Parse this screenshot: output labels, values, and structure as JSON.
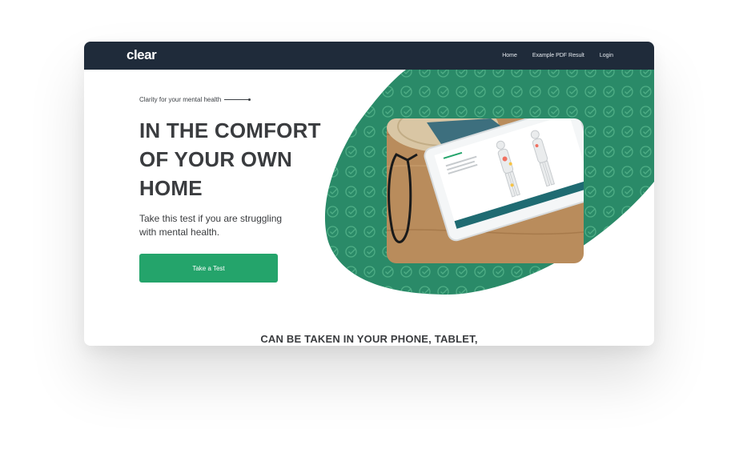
{
  "nav": {
    "logo": "clear",
    "links": [
      "Home",
      "Example PDF Result",
      "Login"
    ]
  },
  "hero": {
    "tagline": "Clarity for your mental health",
    "title_lines": [
      "IN THE COMFORT",
      "OF YOUR OWN",
      "HOME"
    ],
    "subtitle_lines": [
      "Take this test if you are struggling",
      "with mental health."
    ],
    "cta_label": "Take a Test"
  },
  "section": {
    "heading": "CAN BE TAKEN IN YOUR PHONE, TABLET,"
  },
  "colors": {
    "navbar": "#1f2b3a",
    "accent_green": "#24a46b",
    "blob_green": "#2a8a68",
    "text_dark": "#3a3c3f"
  },
  "icons": [
    "check-circle-icon"
  ]
}
